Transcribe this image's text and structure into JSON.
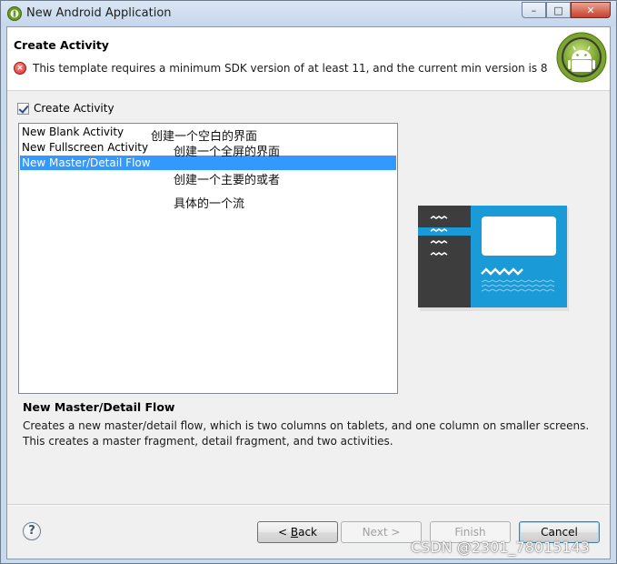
{
  "window": {
    "title": "New Android Application",
    "controls": {
      "minimize": "–",
      "maximize": "□",
      "close": "✕"
    }
  },
  "header": {
    "title": "Create Activity",
    "error_message": "This template requires a minimum SDK version of at least 11, and the current min version is 8"
  },
  "create_activity": {
    "label": "Create Activity",
    "checked": true
  },
  "templates": [
    {
      "label": "New Blank Activity",
      "selected": false
    },
    {
      "label": "New Fullscreen Activity",
      "selected": false
    },
    {
      "label": "New Master/Detail Flow",
      "selected": true
    }
  ],
  "annotations": [
    "创建一个空白的界面",
    "创建一个全屏的界面",
    "创建一个主要的或者",
    "具体的一个流"
  ],
  "description": {
    "title": "New Master/Detail Flow",
    "text": "Creates a new master/detail flow, which is two columns on tablets, and one column on smaller screens. This creates a master fragment, detail fragment, and two activities."
  },
  "footer": {
    "help": "?",
    "back": "Back",
    "back_prefix": "< ",
    "back_mnemonic": "B",
    "back_rest": "ack",
    "next": "Next >",
    "finish": "Finish",
    "cancel": "Cancel"
  },
  "watermark": "CSDN @2301_78015143",
  "colors": {
    "selection": "#3399ff",
    "preview_blue": "#1a9ad6",
    "preview_dark": "#3d3d3d",
    "error_red": "#d32f2f"
  }
}
